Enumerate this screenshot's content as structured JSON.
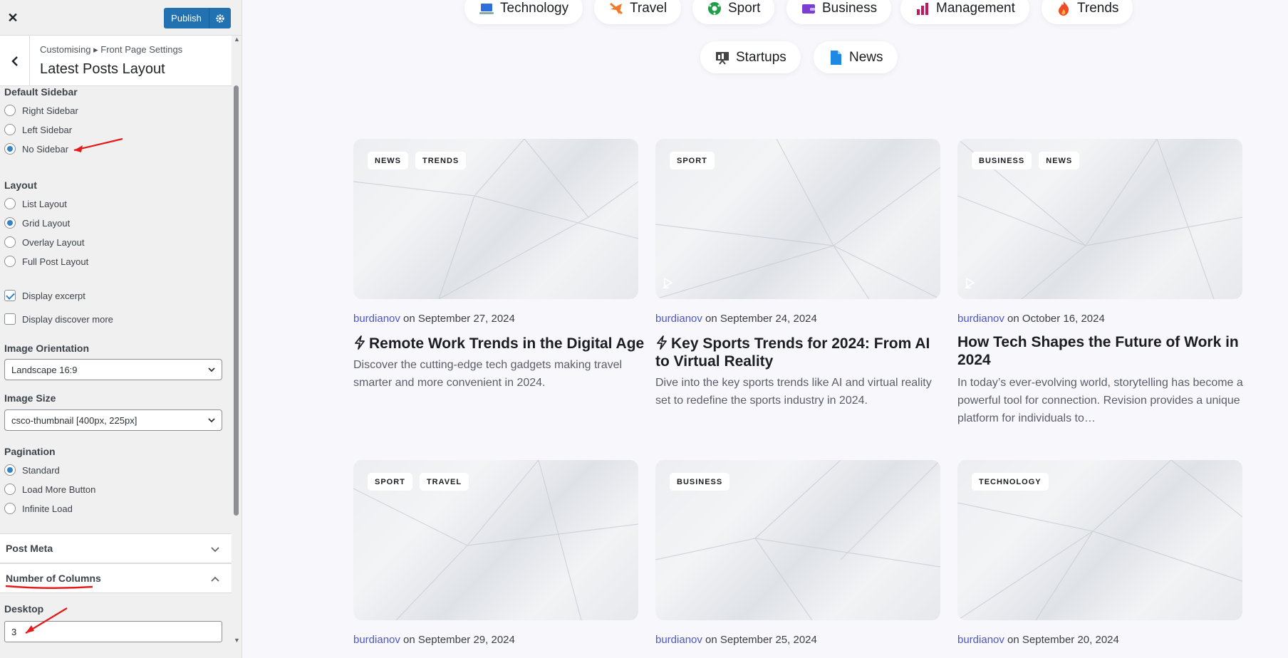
{
  "customizer": {
    "publish_label": "Publish",
    "breadcrumb": "Customising ▸ Front Page Settings",
    "section_title": "Latest Posts Layout",
    "default_sidebar": {
      "label": "Default Sidebar",
      "options": [
        "Right Sidebar",
        "Left Sidebar",
        "No Sidebar"
      ],
      "selected": "No Sidebar"
    },
    "layout": {
      "label": "Layout",
      "options": [
        "List Layout",
        "Grid Layout",
        "Overlay Layout",
        "Full Post Layout"
      ],
      "selected": "Grid Layout"
    },
    "checkboxes": [
      {
        "label": "Display excerpt",
        "checked": true
      },
      {
        "label": "Display discover more",
        "checked": false
      }
    ],
    "image_orientation": {
      "label": "Image Orientation",
      "value": "Landscape 16:9"
    },
    "image_size": {
      "label": "Image Size",
      "value": "csco-thumbnail [400px, 225px]"
    },
    "pagination": {
      "label": "Pagination",
      "options": [
        "Standard",
        "Load More Button",
        "Infinite Load"
      ],
      "selected": "Standard"
    },
    "post_meta_label": "Post Meta",
    "columns_label": "Number of Columns",
    "desktop_label": "Desktop",
    "desktop_value": "3"
  },
  "site": {
    "categories_row1": [
      {
        "name": "Technology",
        "icon": "laptop-icon",
        "color": "#2f6fdb"
      },
      {
        "name": "Travel",
        "icon": "airplane-icon",
        "color": "#f07a2b"
      },
      {
        "name": "Sport",
        "icon": "soccer-ball-icon",
        "color": "#1e9e4a"
      },
      {
        "name": "Business",
        "icon": "wallet-icon",
        "color": "#7a3fd1"
      },
      {
        "name": "Management",
        "icon": "bar-chart-icon",
        "color": "#c2185b"
      },
      {
        "name": "Trends",
        "icon": "fire-icon",
        "color": "#ef4b24"
      }
    ],
    "categories_row2": [
      {
        "name": "Startups",
        "icon": "presentation-icon",
        "color": "#444"
      },
      {
        "name": "News",
        "icon": "document-icon",
        "color": "#1e88e5"
      }
    ],
    "posts": [
      {
        "tags": [
          "NEWS",
          "TRENDS"
        ],
        "author": "burdianov",
        "date": "on September 27, 2024",
        "title": "Remote Work Trends in the Digital Age",
        "flash": true,
        "video": false,
        "excerpt": "Discover the cutting-edge tech gadgets making travel smarter and more convenient in 2024."
      },
      {
        "tags": [
          "SPORT"
        ],
        "author": "burdianov",
        "date": "on September 24, 2024",
        "title": "Key Sports Trends for 2024: From AI to Virtual Reality",
        "flash": true,
        "video": true,
        "excerpt": "Dive into the key sports trends like AI and virtual reality set to redefine the sports industry in 2024."
      },
      {
        "tags": [
          "BUSINESS",
          "NEWS"
        ],
        "author": "burdianov",
        "date": "on October 16, 2024",
        "title": "How Tech Shapes the Future of Work in 2024",
        "flash": false,
        "video": true,
        "excerpt": "In today’s ever-evolving world, storytelling has become a powerful tool for connection. Revision provides a unique platform for individuals to…"
      },
      {
        "tags": [
          "SPORT",
          "TRAVEL"
        ],
        "author": "burdianov",
        "date": "on September 29, 2024",
        "title": "",
        "flash": false,
        "video": false,
        "excerpt": ""
      },
      {
        "tags": [
          "BUSINESS"
        ],
        "author": "burdianov",
        "date": "on September 25, 2024",
        "title": "",
        "flash": false,
        "video": false,
        "excerpt": ""
      },
      {
        "tags": [
          "TECHNOLOGY"
        ],
        "author": "burdianov",
        "date": "on September 20, 2024",
        "title": "",
        "flash": false,
        "video": false,
        "excerpt": ""
      }
    ]
  },
  "colors": {
    "accent": "#2271b1",
    "author": "#4b55c8",
    "annotation": "#e31b1b"
  }
}
